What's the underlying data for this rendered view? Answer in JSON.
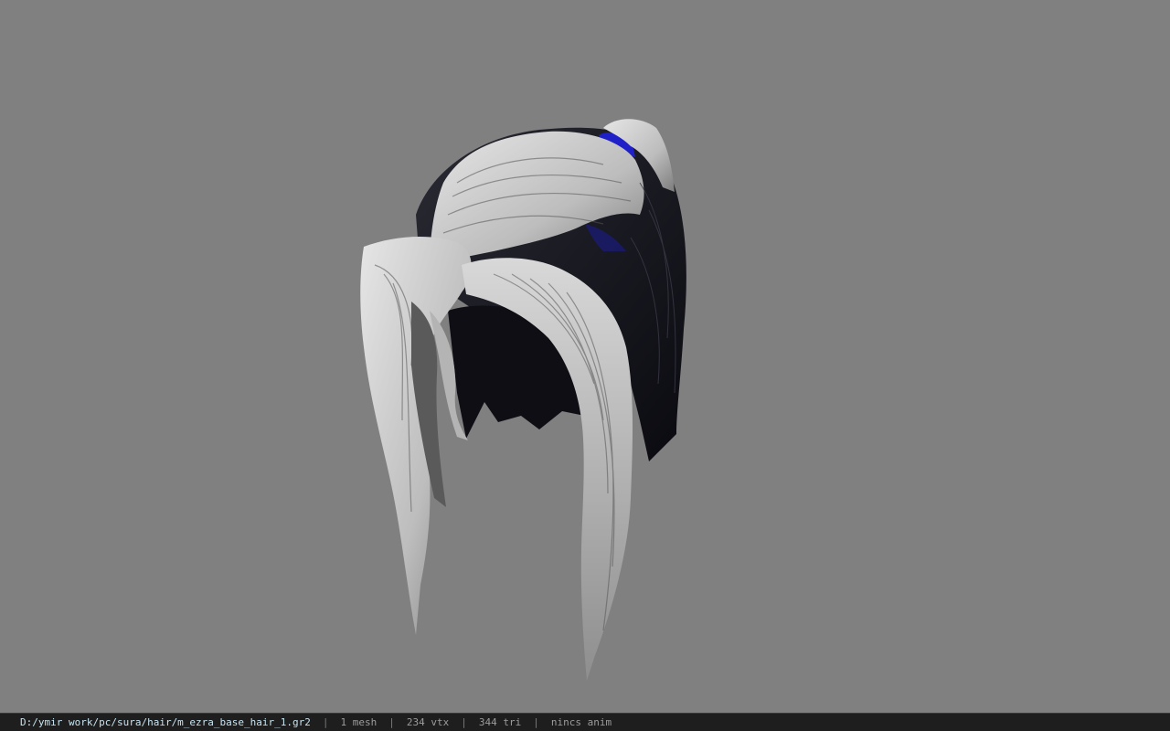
{
  "viewer": {
    "background": "#808080"
  },
  "status_bar": {
    "file_path": "D:/ymir work/pc/sura/hair/m_ezra_base_hair_1.gr2",
    "separator": "|",
    "mesh_count": "1 mesh",
    "vertex_count": "234 vtx",
    "triangle_count": "344 tri",
    "anim_status": "nincs anim",
    "colors": {
      "background": "#1e1e1e",
      "path": "#c7e3f0",
      "text": "#9c9c9c"
    }
  },
  "model": {
    "icon": "hair-mesh",
    "colors": {
      "light": "#d9d9d9",
      "mid": "#9a9a9a",
      "dark": "#121218",
      "accent": "#2020c8"
    }
  }
}
